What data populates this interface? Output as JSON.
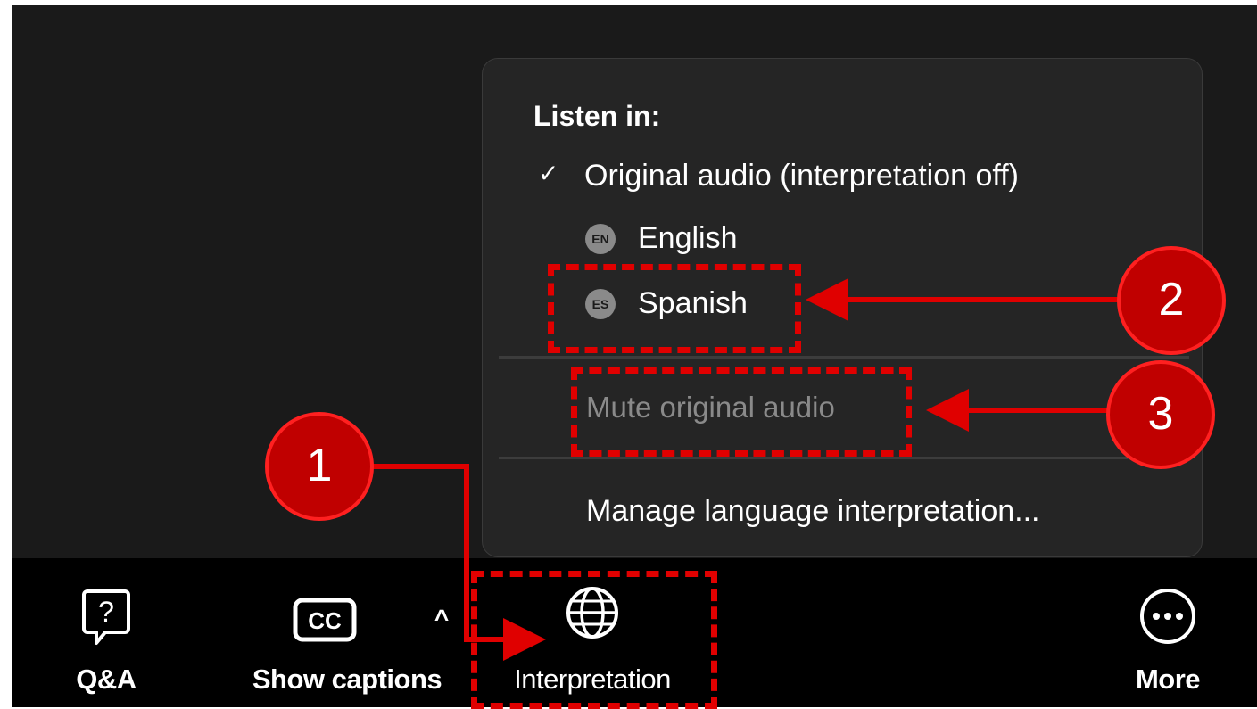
{
  "menu": {
    "heading": "Listen in:",
    "checkmark": "✓",
    "original_audio": "Original audio (interpretation off)",
    "languages": [
      {
        "badge": "EN",
        "label": "English"
      },
      {
        "badge": "ES",
        "label": "Spanish"
      }
    ],
    "mute_original": "Mute original audio",
    "manage": "Manage language interpretation..."
  },
  "toolbar": {
    "qa": {
      "label": "Q&A",
      "icon": "question-bubble-icon"
    },
    "captions": {
      "label": "Show captions",
      "icon": "cc-icon",
      "caret": "^"
    },
    "interpretation": {
      "label": "Interpretation",
      "icon": "globe-icon"
    },
    "more": {
      "label": "More",
      "icon": "more-dots-icon"
    }
  },
  "annotations": {
    "callouts": [
      "1",
      "2",
      "3"
    ],
    "color": "#e00000"
  }
}
